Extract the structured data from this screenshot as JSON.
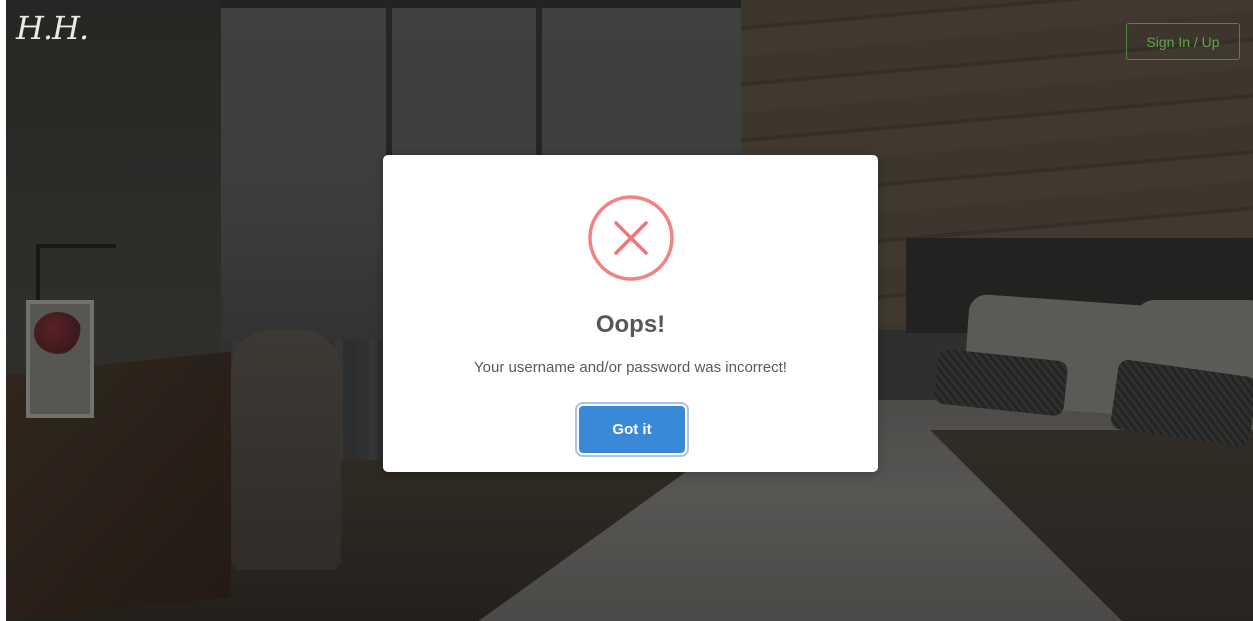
{
  "header": {
    "logo_text": "H.H.",
    "signin_label": "Sign In / Up"
  },
  "modal": {
    "icon": "x-circle-icon",
    "title": "Oops!",
    "message": "Your username and/or password was incorrect!",
    "confirm_label": "Got it"
  },
  "colors": {
    "accent_green": "#5ea64a",
    "error_red": "#f27474",
    "button_blue": "#3a88d8"
  }
}
